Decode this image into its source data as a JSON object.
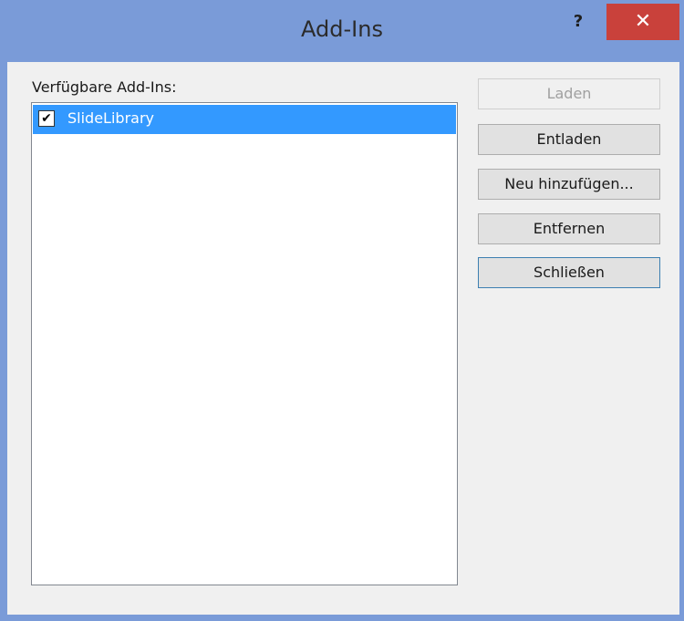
{
  "window": {
    "title": "Add-Ins",
    "help_label": "?",
    "close_label": "✕"
  },
  "list": {
    "label": "Verfügbare Add-Ins:",
    "items": [
      {
        "label": "SlideLibrary",
        "checked": true,
        "check_glyph": "✔"
      }
    ]
  },
  "buttons": {
    "load": "Laden",
    "unload": "Entladen",
    "add_new": "Neu hinzufügen...",
    "remove": "Entfernen",
    "close": "Schließen"
  },
  "colors": {
    "titlebar": "#7a9bd8",
    "close_button": "#c9413b",
    "selection": "#3399ff"
  }
}
